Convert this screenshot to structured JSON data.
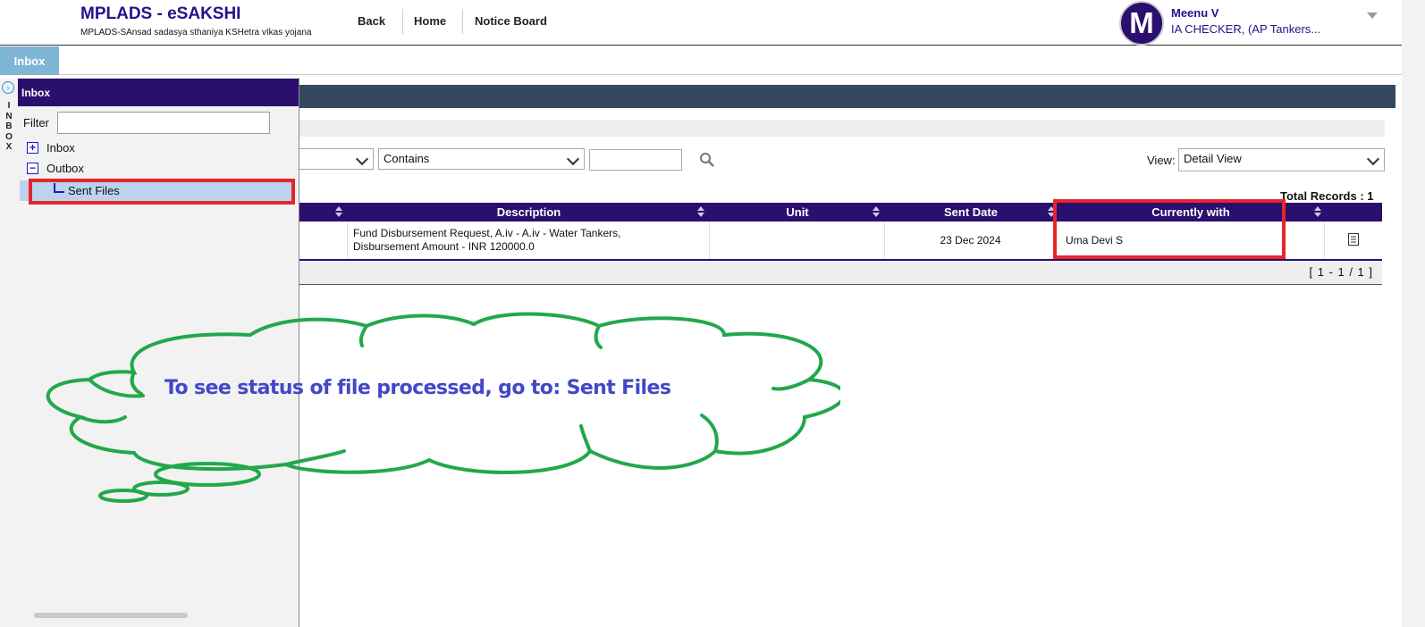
{
  "header": {
    "app_title": "MPLADS - eSAKSHI",
    "app_subtitle": "MPLADS-SAnsad sadasya sthaniya KSHetra vIkas yojana",
    "nav": [
      "Back",
      "Home",
      "Notice Board"
    ],
    "user": {
      "initial": "M",
      "name": "Meenu V",
      "role": "IA CHECKER, (AP Tankers..."
    }
  },
  "tabs": {
    "active": "Inbox"
  },
  "side_strip": {
    "label": "INBOX"
  },
  "inbox_panel": {
    "title": "Inbox",
    "filter_label": "Filter",
    "filter_value": "",
    "tree": {
      "inbox": {
        "toggle": "+",
        "label": "Inbox"
      },
      "outbox": {
        "toggle": "−",
        "label": "Outbox"
      },
      "sent_files": {
        "label": "Sent Files",
        "selected": true
      }
    }
  },
  "toolbar": {
    "field_value": "",
    "operator_value": "Contains",
    "search_value": "",
    "view_label": "View:",
    "view_value": "Detail View",
    "total_records": "Total Records : 1"
  },
  "table": {
    "columns": [
      "",
      "Description",
      "Unit",
      "Sent Date",
      "Currently with",
      ""
    ],
    "rows": [
      {
        "description_line1": "Fund Disbursement Request, A.iv - A.iv - Water Tankers,",
        "description_line2": "Disbursement Amount - INR 120000.0",
        "unit": "",
        "sent_date": "23 Dec 2024",
        "currently_with": "Uma Devi S"
      }
    ],
    "pager": "[ 1 - 1 / 1 ]"
  },
  "annotation": {
    "cloud_text": "To see status of file processed, go to: Sent Files",
    "highlight_color": "#e8242b",
    "cloud_color": "#22a84a",
    "text_color": "#4248c9"
  },
  "colors": {
    "brand": "#2b0f6e",
    "tab_active": "#7fb5d5",
    "header_bar": "#34495e"
  }
}
